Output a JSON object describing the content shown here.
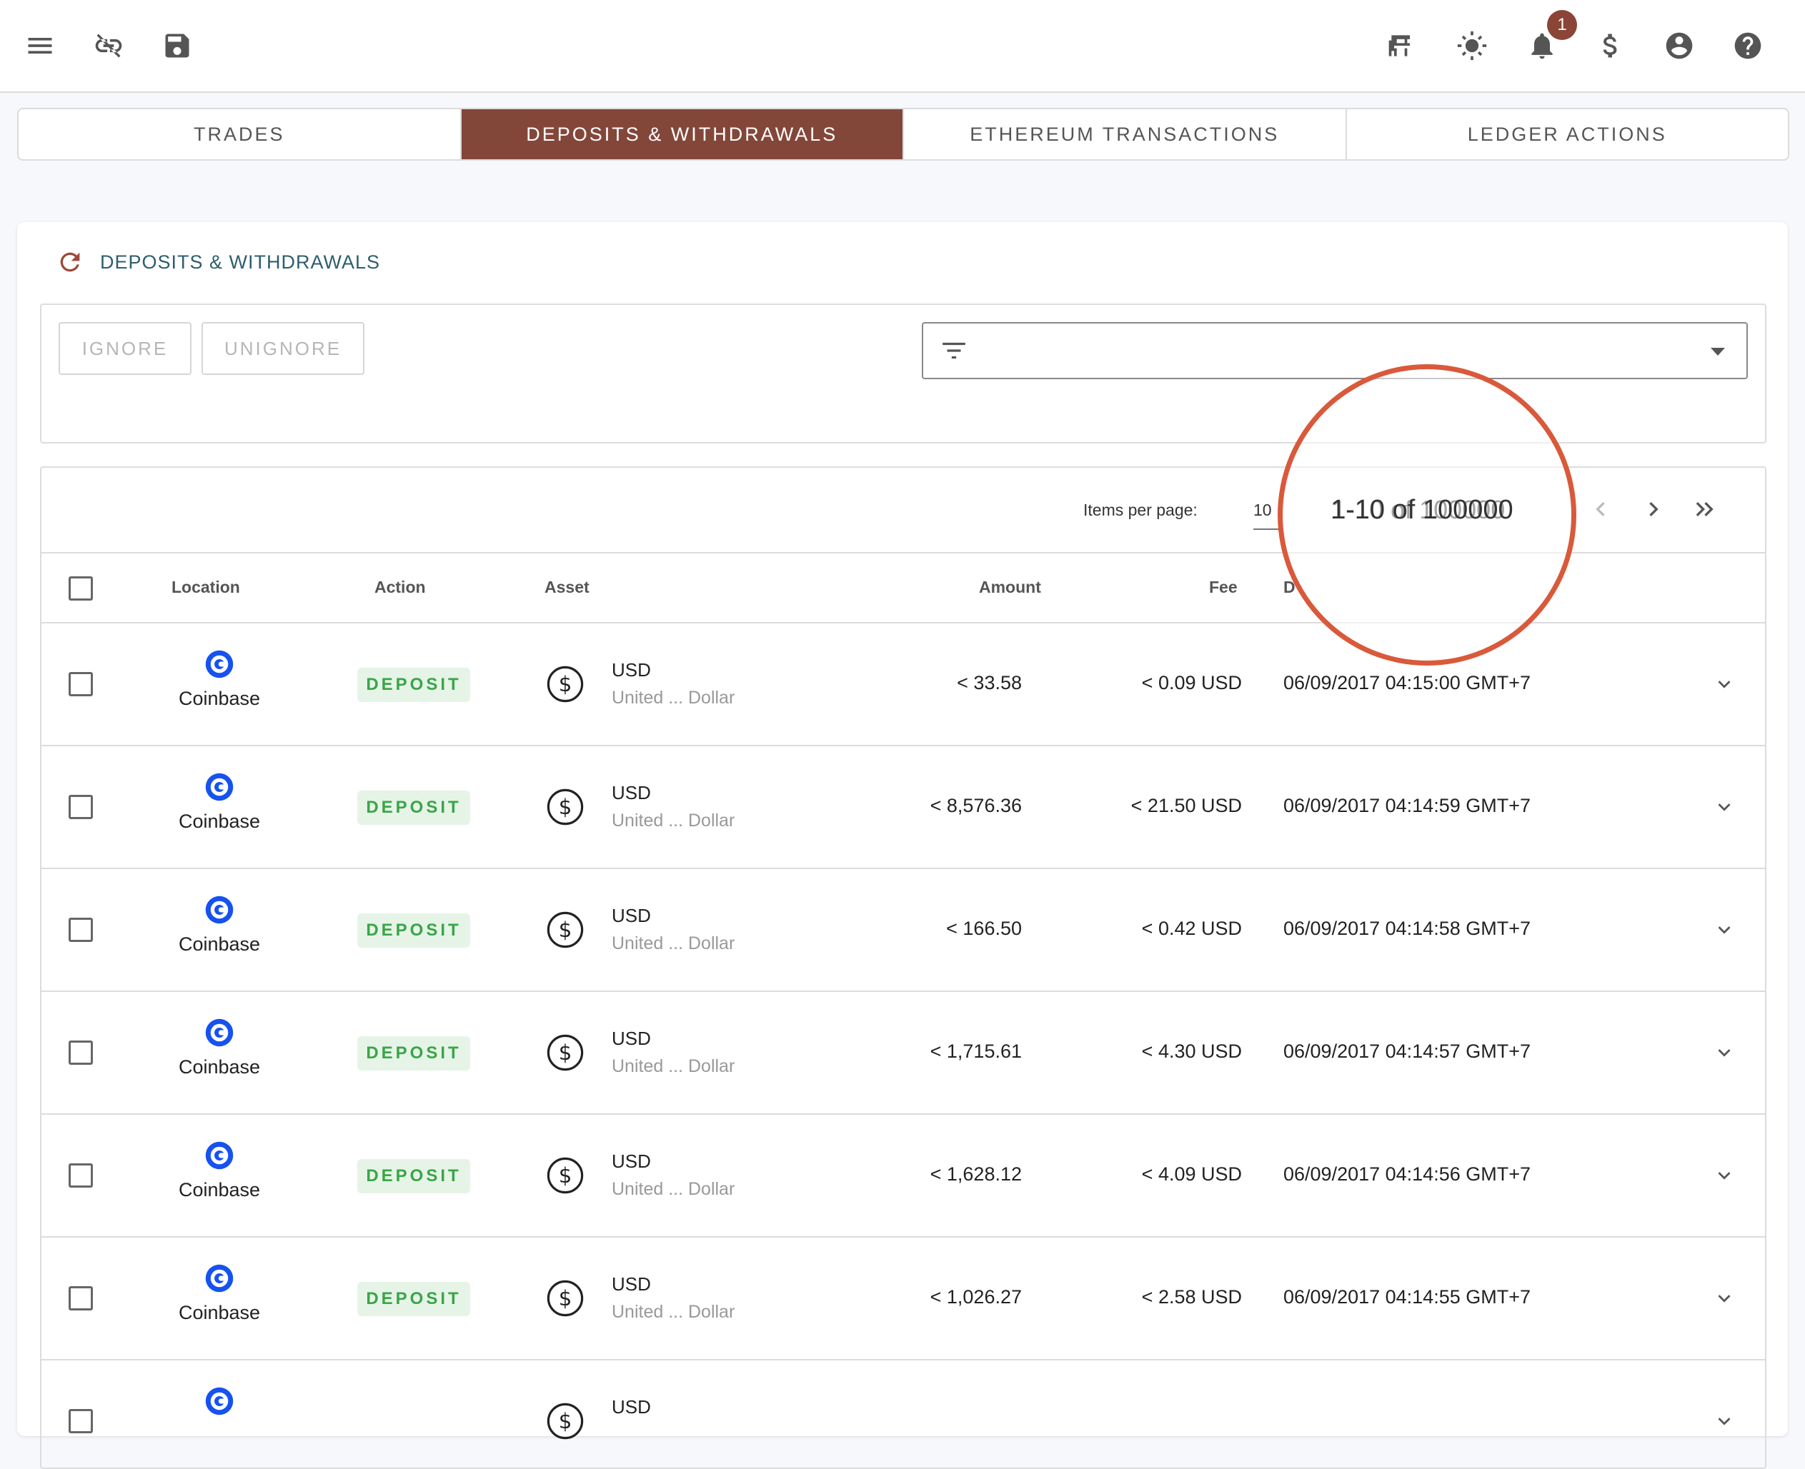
{
  "topbar": {
    "left_icons": [
      "menu-icon",
      "link-off-icon",
      "save-icon"
    ],
    "right_icons": [
      "pinned-icon",
      "theme-sun-icon",
      "notifications-bell-icon",
      "currency-dollar-icon",
      "account-circle-icon",
      "help-circle-icon"
    ],
    "notification_count": "1"
  },
  "tabs": [
    {
      "label": "TRADES",
      "active": false
    },
    {
      "label": "DEPOSITS & WITHDRAWALS",
      "active": true
    },
    {
      "label": "ETHEREUM TRANSACTIONS",
      "active": false
    },
    {
      "label": "LEDGER ACTIONS",
      "active": false
    }
  ],
  "card": {
    "title": "DEPOSITS & WITHDRAWALS",
    "ignore_label": "IGNORE",
    "unignore_label": "UNIGNORE",
    "filter_placeholder": ""
  },
  "pager": {
    "items_per_page_label": "Items per page:",
    "items_per_page_value": "10",
    "range": "1-10 of 100000"
  },
  "table": {
    "headers": {
      "location": "Location",
      "action": "Action",
      "asset": "Asset",
      "amount": "Amount",
      "fee": "Fee",
      "date": "D"
    },
    "rows": [
      {
        "location": "Coinbase",
        "action": "DEPOSIT",
        "asset_symbol": "USD",
        "asset_name": "United ... Dollar",
        "amount": "< 33.58",
        "fee": "< 0.09 USD",
        "date": "06/09/2017 04:15:00 GMT+7"
      },
      {
        "location": "Coinbase",
        "action": "DEPOSIT",
        "asset_symbol": "USD",
        "asset_name": "United ... Dollar",
        "amount": "< 8,576.36",
        "fee": "< 21.50 USD",
        "date": "06/09/2017 04:14:59 GMT+7"
      },
      {
        "location": "Coinbase",
        "action": "DEPOSIT",
        "asset_symbol": "USD",
        "asset_name": "United ... Dollar",
        "amount": "< 166.50",
        "fee": "< 0.42 USD",
        "date": "06/09/2017 04:14:58 GMT+7"
      },
      {
        "location": "Coinbase",
        "action": "DEPOSIT",
        "asset_symbol": "USD",
        "asset_name": "United ... Dollar",
        "amount": "< 1,715.61",
        "fee": "< 4.30 USD",
        "date": "06/09/2017 04:14:57 GMT+7"
      },
      {
        "location": "Coinbase",
        "action": "DEPOSIT",
        "asset_symbol": "USD",
        "asset_name": "United ... Dollar",
        "amount": "< 1,628.12",
        "fee": "< 4.09 USD",
        "date": "06/09/2017 04:14:56 GMT+7"
      },
      {
        "location": "Coinbase",
        "action": "DEPOSIT",
        "asset_symbol": "USD",
        "asset_name": "United ... Dollar",
        "amount": "< 1,026.27",
        "fee": "< 2.58 USD",
        "date": "06/09/2017 04:14:55 GMT+7"
      },
      {
        "location": "",
        "action": "",
        "asset_symbol": "USD",
        "asset_name": "",
        "amount": "",
        "fee": "",
        "date": ""
      }
    ]
  },
  "colors": {
    "accent": "#83473a",
    "badge": "#8b4536",
    "title_text": "#2e5e6e",
    "deposit_bg": "#e6f4e7",
    "deposit_text": "#3aa548",
    "coinbase_blue": "#1652f0",
    "highlight_circle": "#d9593a"
  }
}
